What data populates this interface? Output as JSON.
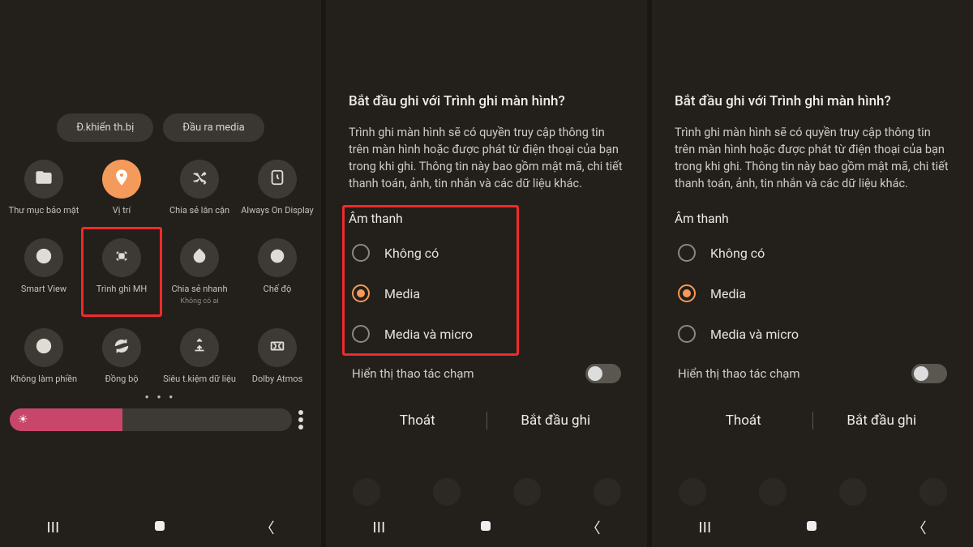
{
  "panel1": {
    "top_pills": [
      {
        "label": "Đ.khiển th.bị"
      },
      {
        "label": "Đầu ra media"
      }
    ],
    "tiles": [
      {
        "icon": "folder-lock-icon",
        "label": "Thư mục bảo mật",
        "active": false
      },
      {
        "icon": "location-icon",
        "label": "Vị trí",
        "active": true
      },
      {
        "icon": "shuffle-icon",
        "label": "Chia sẻ lân cận",
        "active": false
      },
      {
        "icon": "clock-icon",
        "label": "Always On Display",
        "active": false
      },
      {
        "icon": "play-circle-icon",
        "label": "Smart View",
        "active": false
      },
      {
        "icon": "screen-record-icon",
        "label": "Trình ghi MH",
        "active": false,
        "highlight": true
      },
      {
        "icon": "quick-share-icon",
        "label": "Chia sẻ nhanh",
        "sublabel": "Không có ai",
        "active": false
      },
      {
        "icon": "mode-icon",
        "label": "Chế độ",
        "active": false
      },
      {
        "icon": "minus-circle-icon",
        "label": "Không làm phiền",
        "active": false
      },
      {
        "icon": "sync-icon",
        "label": "Đồng bộ",
        "active": false
      },
      {
        "icon": "data-saver-icon",
        "label": "Siêu t.kiệm dữ liệu",
        "active": false
      },
      {
        "icon": "dolby-icon",
        "label": "Dolby Atmos",
        "active": false
      }
    ],
    "brightness_pct": 40
  },
  "dialog": {
    "title": "Bắt đầu ghi với Trình ghi màn hình?",
    "body": "Trình ghi màn hình sẽ có quyền truy cập thông tin trên màn hình hoặc được phát từ điện thoại của bạn trong khi ghi. Thông tin này bao gồm mật mã, chi tiết thanh toán, ảnh, tin nhắn và các dữ liệu khác.",
    "section_label": "Âm thanh",
    "options": [
      {
        "label": "Không có",
        "selected": false
      },
      {
        "label": "Media",
        "selected": true
      },
      {
        "label": "Media và micro",
        "selected": false
      }
    ],
    "toggle_label": "Hiển thị thao tác chạm",
    "toggle_on": false,
    "cancel": "Thoát",
    "start": "Bắt đầu ghi"
  },
  "accent_color": "#f49a5a",
  "highlight_color": "#f02b2b"
}
